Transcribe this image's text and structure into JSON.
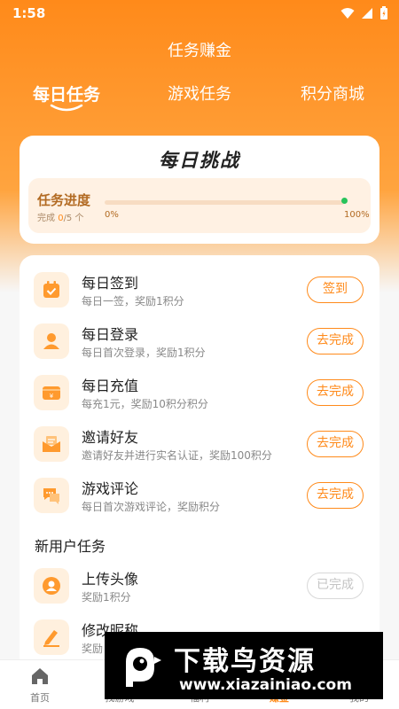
{
  "status": {
    "time": "1:58"
  },
  "header": {
    "title": "任务赚金"
  },
  "tabs": [
    {
      "label": "每日任务",
      "active": true
    },
    {
      "label": "游戏任务",
      "active": false
    },
    {
      "label": "积分商城",
      "active": false
    }
  ],
  "challenge": {
    "title": "每日挑战",
    "progress_label": "任务进度",
    "completed_prefix": "完成 ",
    "completed": "0",
    "total": "/5 个",
    "min": "0%",
    "max": "100%",
    "progress_fraction": 0.0
  },
  "tasks": [
    {
      "name": "每日签到",
      "desc": "每日一签，奖励1积分",
      "button": "签到",
      "icon": "calendar-check-icon",
      "done": false
    },
    {
      "name": "每日登录",
      "desc": "每日首次登录，奖励1积分",
      "button": "去完成",
      "icon": "user-icon",
      "done": false
    },
    {
      "name": "每日充值",
      "desc": "每充1元，奖励10积分积分",
      "button": "去完成",
      "icon": "wallet-yen-icon",
      "done": false
    },
    {
      "name": "邀请好友",
      "desc": "邀请好友并进行实名认证，奖励100积分",
      "button": "去完成",
      "icon": "mail-invite-icon",
      "done": false
    },
    {
      "name": "游戏评论",
      "desc": "每日首次游戏评论，奖励积分",
      "button": "去完成",
      "icon": "comment-icon",
      "done": false
    }
  ],
  "new_user": {
    "section_title": "新用户任务",
    "tasks": [
      {
        "name": "上传头像",
        "desc": "奖励1积分",
        "button": "已完成",
        "icon": "avatar-upload-icon",
        "done": true
      },
      {
        "name": "修改昵称",
        "desc": "奖励",
        "button": "",
        "icon": "edit-pen-icon",
        "done": false
      }
    ]
  },
  "bottom_nav": [
    {
      "label": "首页",
      "icon": "home-icon",
      "active": false
    },
    {
      "label": "找游戏",
      "icon": "gamepad-icon",
      "active": false
    },
    {
      "label": "福利",
      "icon": "gift-icon",
      "active": false
    },
    {
      "label": "赚金",
      "icon": "coin-icon",
      "active": true
    },
    {
      "label": "我的",
      "icon": "profile-icon",
      "active": false
    }
  ],
  "watermark": {
    "title": "下载鸟资源",
    "url": "www.xiazainiao.com"
  },
  "colors": {
    "accent": "#ff8a1a",
    "background": "#f7f7f7",
    "done": "#c4c4c4"
  }
}
